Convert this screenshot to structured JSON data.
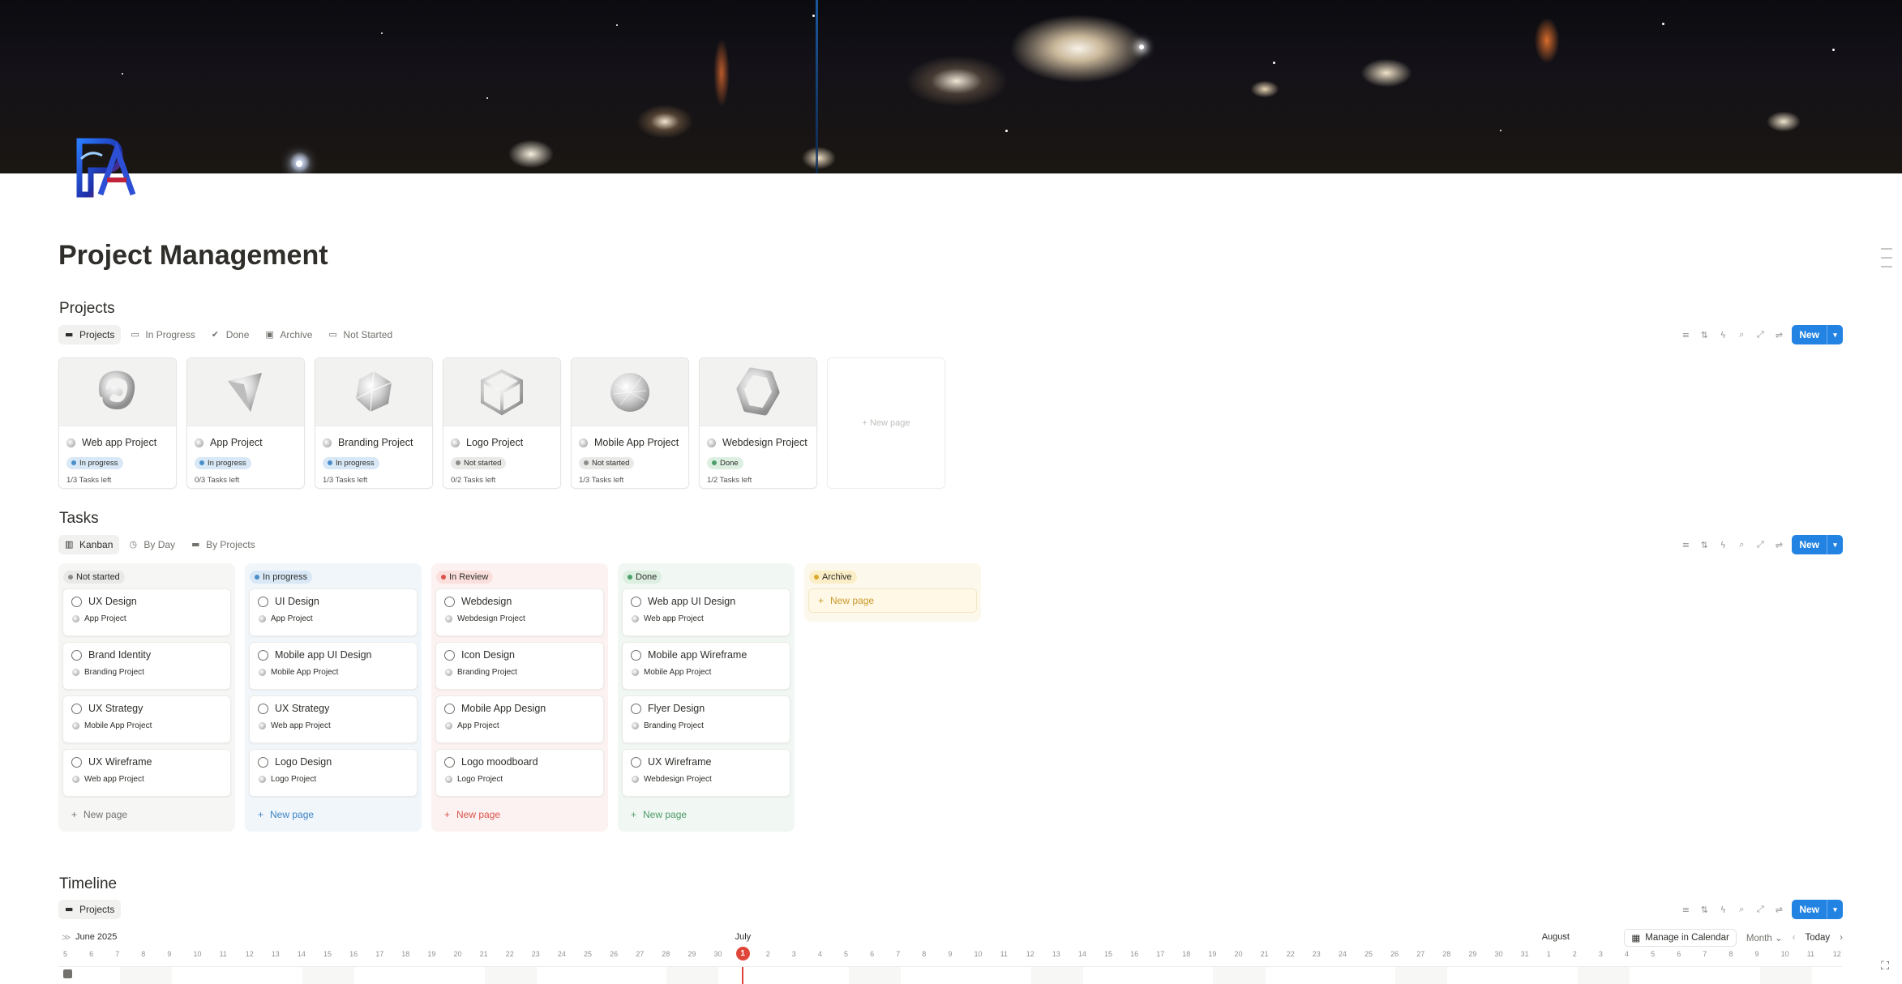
{
  "page": {
    "title": "Project Management"
  },
  "colors": {
    "accent": "#2383e2",
    "today": "#e0453a"
  },
  "icons": {
    "logo": "pa-monogram-logo",
    "cover": "galaxy-cover-image"
  },
  "projects": {
    "title": "Projects",
    "views": [
      {
        "label": "Projects",
        "icon": "folder-icon",
        "active": true
      },
      {
        "label": "In Progress",
        "icon": "printer-icon",
        "active": false
      },
      {
        "label": "Done",
        "icon": "check-circle-icon",
        "active": false
      },
      {
        "label": "Archive",
        "icon": "archive-icon",
        "active": false
      },
      {
        "label": "Not Started",
        "icon": "printer-icon",
        "active": false
      }
    ],
    "new_label": "New",
    "cards": [
      {
        "name": "Web app Project",
        "status": "In progress",
        "status_color": "blue",
        "tasks": "1/3 Tasks left",
        "shape": "swirl"
      },
      {
        "name": "App Project",
        "status": "In progress",
        "status_color": "blue",
        "tasks": "0/3 Tasks left",
        "shape": "cone"
      },
      {
        "name": "Branding Project",
        "status": "In progress",
        "status_color": "blue",
        "tasks": "1/3 Tasks left",
        "shape": "polyhedron"
      },
      {
        "name": "Logo Project",
        "status": "Not started",
        "status_color": "gray",
        "tasks": "0/2 Tasks left",
        "shape": "cube-frame"
      },
      {
        "name": "Mobile App Project",
        "status": "Not started",
        "status_color": "gray",
        "tasks": "1/3 Tasks left",
        "shape": "sphere"
      },
      {
        "name": "Webdesign Project",
        "status": "Done",
        "status_color": "green",
        "tasks": "1/2 Tasks left",
        "shape": "hexagon"
      }
    ],
    "new_page_label": "+ New page"
  },
  "tasks": {
    "title": "Tasks",
    "views": [
      {
        "label": "Kanban",
        "icon": "kanban-icon",
        "active": true
      },
      {
        "label": "By Day",
        "icon": "clock-icon",
        "active": false
      },
      {
        "label": "By Projects",
        "icon": "folder-icon",
        "active": false
      }
    ],
    "new_label": "New",
    "columns": [
      {
        "title": "Not started",
        "color": "gray",
        "bg": "#f6f6f4",
        "new_color": "#73726d",
        "cards": [
          {
            "title": "UX Design",
            "project": "App Project"
          },
          {
            "title": "Brand Identity",
            "project": "Branding Project"
          },
          {
            "title": "UX Strategy",
            "project": "Mobile App Project"
          },
          {
            "title": "UX Wireframe",
            "project": "Web app Project"
          }
        ]
      },
      {
        "title": "In progress",
        "color": "blue",
        "bg": "#f1f6fb",
        "new_color": "#3c84c4",
        "cards": [
          {
            "title": "UI Design",
            "project": "App Project"
          },
          {
            "title": "Mobile app UI Design",
            "project": "Mobile App Project"
          },
          {
            "title": "UX Strategy",
            "project": "Web app Project"
          },
          {
            "title": "Logo Design",
            "project": "Logo Project"
          }
        ]
      },
      {
        "title": "In Review",
        "color": "red",
        "bg": "#fcf2f1",
        "new_color": "#d9534b",
        "cards": [
          {
            "title": "Webdesign",
            "project": "Webdesign Project"
          },
          {
            "title": "Icon Design",
            "project": "Branding Project"
          },
          {
            "title": "Mobile App Design",
            "project": "App Project"
          },
          {
            "title": "Logo moodboard",
            "project": "Logo Project"
          }
        ]
      },
      {
        "title": "Done",
        "color": "green",
        "bg": "#f1f7f3",
        "new_color": "#4c9a68",
        "cards": [
          {
            "title": "Web app UI Design",
            "project": "Web app Project"
          },
          {
            "title": "Mobile app Wireframe",
            "project": "Mobile App Project"
          },
          {
            "title": "Flyer Design",
            "project": "Branding Project"
          },
          {
            "title": "UX Wireframe",
            "project": "Webdesign Project"
          }
        ]
      },
      {
        "title": "Archive",
        "color": "yellow",
        "bg": "#fcf8ec",
        "new_color": "#c99a2a",
        "cards": []
      }
    ],
    "new_page_label": "New page"
  },
  "timeline": {
    "title": "Timeline",
    "views": [
      {
        "label": "Projects",
        "icon": "folder-icon",
        "active": true
      }
    ],
    "new_label": "New",
    "manage_label": "Manage in Calendar",
    "range_label": "Month",
    "today_label": "Today",
    "months": [
      {
        "label": "June 2025",
        "start_index": 0
      },
      {
        "label": "July",
        "start_index": 26
      },
      {
        "label": "August",
        "start_index": 57
      }
    ],
    "days": [
      "5",
      "6",
      "7",
      "8",
      "9",
      "10",
      "11",
      "12",
      "13",
      "14",
      "15",
      "16",
      "17",
      "18",
      "19",
      "20",
      "21",
      "22",
      "23",
      "24",
      "25",
      "26",
      "27",
      "28",
      "29",
      "30",
      "1",
      "2",
      "3",
      "4",
      "5",
      "6",
      "7",
      "8",
      "9",
      "10",
      "11",
      "12",
      "13",
      "14",
      "15",
      "16",
      "17",
      "18",
      "19",
      "20",
      "21",
      "22",
      "23",
      "24",
      "25",
      "26",
      "27",
      "28",
      "29",
      "30",
      "31",
      "1",
      "2",
      "3",
      "4",
      "5",
      "6",
      "7",
      "8",
      "9",
      "10",
      "11",
      "12"
    ],
    "today_index": 26,
    "weekend_start_indices": [
      2,
      9,
      16,
      23,
      30,
      37,
      44,
      51,
      58,
      65
    ]
  }
}
